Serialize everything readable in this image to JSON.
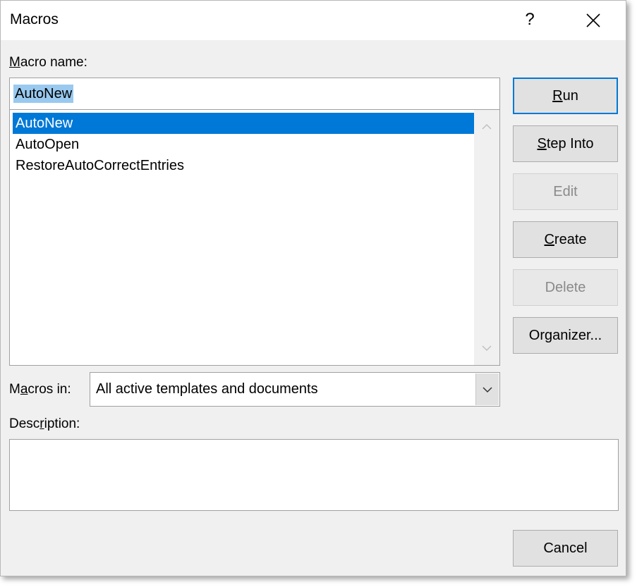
{
  "window": {
    "title": "Macros",
    "help_glyph": "?",
    "close_icon": "close-icon"
  },
  "macro_name": {
    "label_underlined": "M",
    "label_rest": "acro name:",
    "value": "AutoNew"
  },
  "macro_list": {
    "items": [
      "AutoNew",
      "AutoOpen",
      "RestoreAutoCorrectEntries"
    ],
    "selected_index": 0
  },
  "buttons": {
    "run": {
      "pre": "",
      "u": "R",
      "post": "un"
    },
    "step_into": {
      "pre": "",
      "u": "S",
      "post": "tep Into"
    },
    "edit": {
      "pre": "",
      "u": "",
      "post": "Edit"
    },
    "create": {
      "pre": "",
      "u": "C",
      "post": "reate"
    },
    "delete": {
      "pre": "",
      "u": "",
      "post": "Delete"
    },
    "organizer": {
      "pre": "Or",
      "u": "g",
      "post": "anizer..."
    },
    "cancel": {
      "pre": "",
      "u": "",
      "post": "Cancel"
    }
  },
  "macros_in": {
    "label_pre": "M",
    "label_underlined": "a",
    "label_post": "cros in:",
    "value": "All active templates and documents"
  },
  "description": {
    "label_pre": "Desc",
    "label_underlined": "r",
    "label_post": "iption:",
    "value": ""
  },
  "colors": {
    "dialog_bg": "#f0f0f0",
    "selection": "#0078d7",
    "text_selection": "#99c9ef"
  }
}
